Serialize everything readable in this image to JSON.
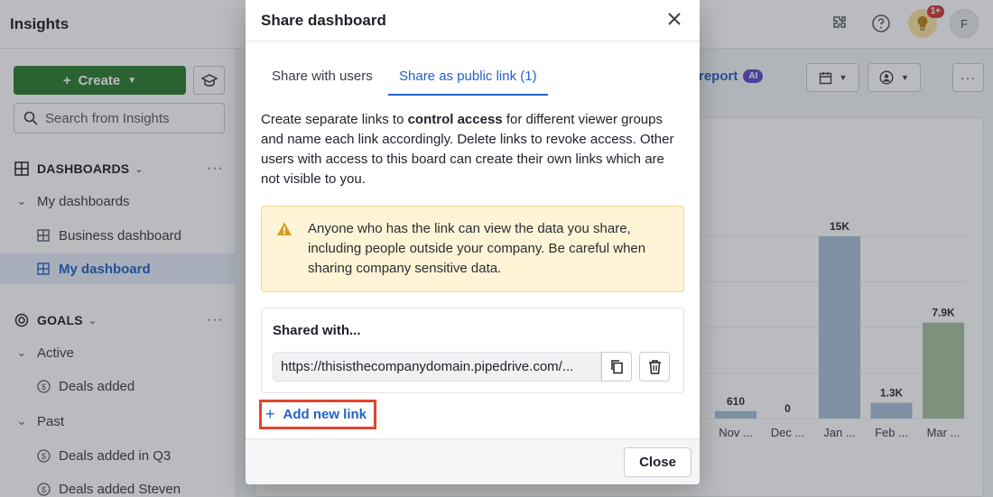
{
  "app": {
    "title": "Insights",
    "notification_count": "1+",
    "avatar_initial": "F"
  },
  "sidebar": {
    "create_label": "Create",
    "search_placeholder": "Search from Insights",
    "dashboards_heading": "DASHBOARDS",
    "my_dashboards_label": "My dashboards",
    "dashboard_items": [
      "Business dashboard",
      "My dashboard"
    ],
    "goals_heading": "GOALS",
    "active_label": "Active",
    "active_goals": [
      "Deals added"
    ],
    "past_label": "Past",
    "past_goals": [
      "Deals added in Q3",
      "Deals added Steven"
    ]
  },
  "toolbar": {
    "report_label": "report",
    "ai_chip": "AI"
  },
  "chart_data": {
    "type": "bar",
    "categories": [
      "Nov ...",
      "Dec ...",
      "Jan ...",
      "Feb ...",
      "Mar ..."
    ],
    "values": [
      610,
      0,
      15000,
      1300,
      7900
    ],
    "value_labels": [
      "610",
      "0",
      "15K",
      "1.3K",
      "7.9K"
    ],
    "colors": [
      "#a9c0d9",
      "#a9c0d9",
      "#a9c0d9",
      "#a9c0d9",
      "#a7c3a0"
    ]
  },
  "modal": {
    "title": "Share dashboard",
    "tabs": [
      "Share with users",
      "Share as public link (1)"
    ],
    "active_tab": 1,
    "description": {
      "part1": "Create separate links to ",
      "bold": "control access",
      "part2": " for different viewer groups and name each link accordingly. Delete links to revoke access. Other users with access to this board can create their own links which are not visible to you."
    },
    "warning": "Anyone who has the link can view the data you share, including people outside your company. Be careful when sharing company sensitive data.",
    "shared_with_title": "Shared with...",
    "link_value": "https://thisisthecompanydomain.pipedrive.com/...",
    "add_link_label": "Add new link",
    "close_label": "Close"
  }
}
